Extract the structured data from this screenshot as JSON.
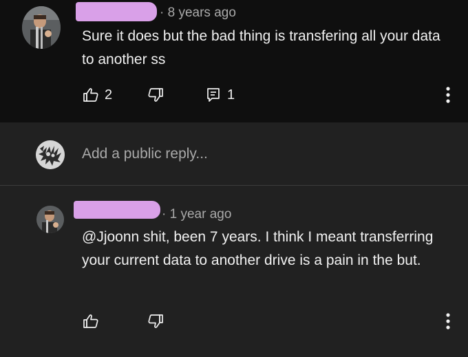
{
  "comment_top": {
    "meta": "· 8 years ago",
    "text": "Sure it does but the bad thing is transfering all your data to another ss",
    "likes": "2",
    "replies": "1",
    "icons": {
      "like": "thumbs-up-icon",
      "dislike": "thumbs-down-icon",
      "reply": "reply-comment-icon",
      "more": "more-vert-icon"
    }
  },
  "reply_box": {
    "placeholder": "Add a public reply..."
  },
  "comment_bottom": {
    "meta": "· 1 year ago",
    "text": "@Jjoonn  shit, been 7 years. I think I meant transferring your current data to another drive is a pain in the but.",
    "icons": {
      "like": "thumbs-up-icon",
      "dislike": "thumbs-down-icon",
      "more": "more-vert-icon"
    }
  },
  "colors": {
    "top_background": "#0f0f0f",
    "page_background": "#212121",
    "text_primary": "#f1f1f1",
    "text_secondary": "#aaaaaa",
    "redaction": "#d9a0e8"
  }
}
